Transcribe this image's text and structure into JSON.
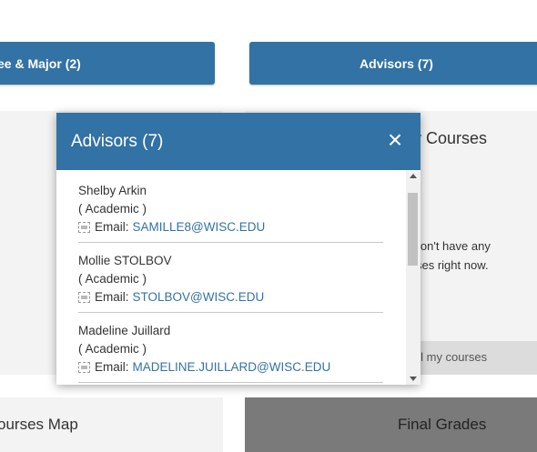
{
  "tabs": {
    "degree_major": "ee & Major (2)",
    "advisors": "Advisors (7)"
  },
  "cards": {
    "right_title": "y Courses",
    "right_msg_line1": "lon't have any",
    "right_msg_line2": "ses right now.",
    "right_footer": "all my courses",
    "bottom_left_title": "ourses Map",
    "bottom_right_title": "Final Grades"
  },
  "modal": {
    "title": "Advisors (7)",
    "close_glyph": "×",
    "email_label": "Email:",
    "advisors": [
      {
        "name": "Shelby Arkin",
        "role": "( Academic )",
        "email": "SAMILLE8@WISC.EDU"
      },
      {
        "name": "Mollie STOLBOV",
        "role": "( Academic )",
        "email": "STOLBOV@WISC.EDU"
      },
      {
        "name": "Madeline Juillard",
        "role": "( Academic )",
        "email": "MADELINE.JUILLARD@WISC.EDU"
      }
    ]
  },
  "icons": {
    "email": "broken-image-icon",
    "close": "close-icon"
  },
  "colors": {
    "primary": "#3272a4",
    "card_bg": "#f3f3f3",
    "dark_card": "#7a7a7a"
  }
}
